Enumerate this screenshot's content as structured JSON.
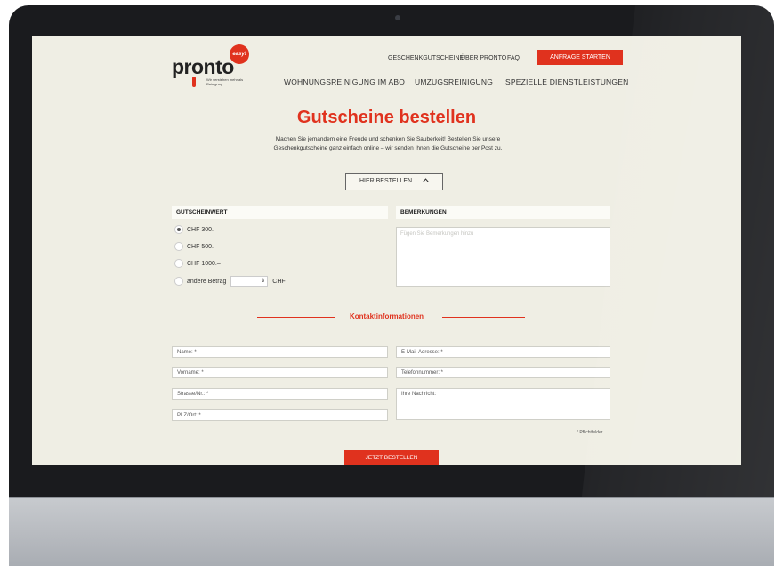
{
  "brand": {
    "name": "pronto",
    "badge": "easy!",
    "tagline": "Wir verstehen mehr als Reinigung",
    "accent": "#e0321e"
  },
  "util_nav": [
    "GESCHENKGUTSCHEINE",
    "ÜBER PRONTO",
    "FAQ"
  ],
  "cta_label": "ANFRAGE STARTEN",
  "main_nav": [
    "WOHNUNGSREINIGUNG IM ABO",
    "UMZUGSREINIGUNG",
    "SPEZIELLE DIENSTLEISTUNGEN"
  ],
  "page": {
    "title": "Gutscheine bestellen",
    "intro_1": "Machen Sie jemandem eine Freude und schenken Sie Sauberkeit! Bestellen Sie unsere",
    "intro_2": "Geschenkgutscheine ganz einfach online – wir senden Ihnen die Gutscheine per Post zu.",
    "order_toggle": "HIER BESTELLEN",
    "order_toggle_icon": "chevron-up-icon"
  },
  "voucher": {
    "heading": "GUTSCHEINWERT",
    "options": [
      "CHF 300.–",
      "CHF 500.–",
      "CHF 1000.–"
    ],
    "selected": "CHF 300.–",
    "other_label": "andere Betrag",
    "other_currency": "CHF"
  },
  "remarks": {
    "heading": "BEMERKUNGEN",
    "placeholder": "Fügen Sie Bemerkungen hinzu"
  },
  "contact": {
    "heading": "Kontaktinformationen",
    "left_fields": [
      "Name: *",
      "Vorname: *",
      "Strasse/Nr.: *",
      "PLZ/Ort: *"
    ],
    "right_fields": [
      "E-Mail-Adresse: *",
      "Telefonnummer: *"
    ],
    "message_label": "Ihre Nachricht:",
    "required_note": "* Pflichtfelder"
  },
  "submit_label": "JETZT BESTELLEN"
}
